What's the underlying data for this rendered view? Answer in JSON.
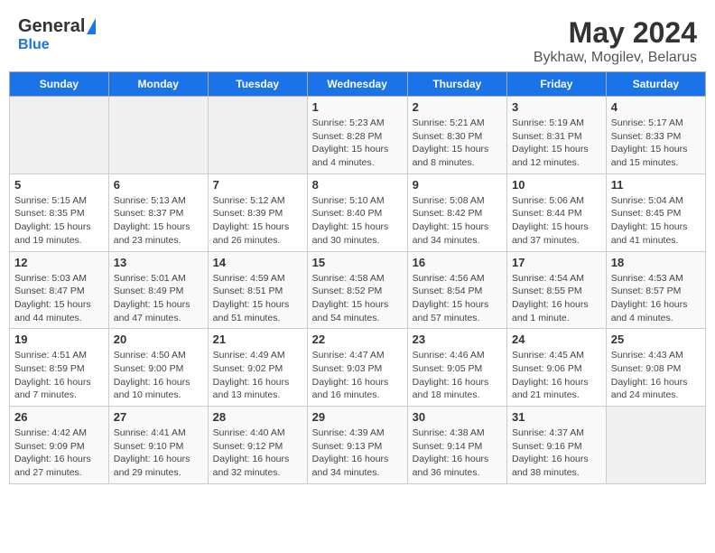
{
  "header": {
    "logo_general": "General",
    "logo_blue": "Blue",
    "title": "May 2024",
    "subtitle": "Bykhaw, Mogilev, Belarus"
  },
  "weekdays": [
    "Sunday",
    "Monday",
    "Tuesday",
    "Wednesday",
    "Thursday",
    "Friday",
    "Saturday"
  ],
  "weeks": [
    [
      {
        "day": "",
        "info": ""
      },
      {
        "day": "",
        "info": ""
      },
      {
        "day": "",
        "info": ""
      },
      {
        "day": "1",
        "info": "Sunrise: 5:23 AM\nSunset: 8:28 PM\nDaylight: 15 hours\nand 4 minutes."
      },
      {
        "day": "2",
        "info": "Sunrise: 5:21 AM\nSunset: 8:30 PM\nDaylight: 15 hours\nand 8 minutes."
      },
      {
        "day": "3",
        "info": "Sunrise: 5:19 AM\nSunset: 8:31 PM\nDaylight: 15 hours\nand 12 minutes."
      },
      {
        "day": "4",
        "info": "Sunrise: 5:17 AM\nSunset: 8:33 PM\nDaylight: 15 hours\nand 15 minutes."
      }
    ],
    [
      {
        "day": "5",
        "info": "Sunrise: 5:15 AM\nSunset: 8:35 PM\nDaylight: 15 hours\nand 19 minutes."
      },
      {
        "day": "6",
        "info": "Sunrise: 5:13 AM\nSunset: 8:37 PM\nDaylight: 15 hours\nand 23 minutes."
      },
      {
        "day": "7",
        "info": "Sunrise: 5:12 AM\nSunset: 8:39 PM\nDaylight: 15 hours\nand 26 minutes."
      },
      {
        "day": "8",
        "info": "Sunrise: 5:10 AM\nSunset: 8:40 PM\nDaylight: 15 hours\nand 30 minutes."
      },
      {
        "day": "9",
        "info": "Sunrise: 5:08 AM\nSunset: 8:42 PM\nDaylight: 15 hours\nand 34 minutes."
      },
      {
        "day": "10",
        "info": "Sunrise: 5:06 AM\nSunset: 8:44 PM\nDaylight: 15 hours\nand 37 minutes."
      },
      {
        "day": "11",
        "info": "Sunrise: 5:04 AM\nSunset: 8:45 PM\nDaylight: 15 hours\nand 41 minutes."
      }
    ],
    [
      {
        "day": "12",
        "info": "Sunrise: 5:03 AM\nSunset: 8:47 PM\nDaylight: 15 hours\nand 44 minutes."
      },
      {
        "day": "13",
        "info": "Sunrise: 5:01 AM\nSunset: 8:49 PM\nDaylight: 15 hours\nand 47 minutes."
      },
      {
        "day": "14",
        "info": "Sunrise: 4:59 AM\nSunset: 8:51 PM\nDaylight: 15 hours\nand 51 minutes."
      },
      {
        "day": "15",
        "info": "Sunrise: 4:58 AM\nSunset: 8:52 PM\nDaylight: 15 hours\nand 54 minutes."
      },
      {
        "day": "16",
        "info": "Sunrise: 4:56 AM\nSunset: 8:54 PM\nDaylight: 15 hours\nand 57 minutes."
      },
      {
        "day": "17",
        "info": "Sunrise: 4:54 AM\nSunset: 8:55 PM\nDaylight: 16 hours\nand 1 minute."
      },
      {
        "day": "18",
        "info": "Sunrise: 4:53 AM\nSunset: 8:57 PM\nDaylight: 16 hours\nand 4 minutes."
      }
    ],
    [
      {
        "day": "19",
        "info": "Sunrise: 4:51 AM\nSunset: 8:59 PM\nDaylight: 16 hours\nand 7 minutes."
      },
      {
        "day": "20",
        "info": "Sunrise: 4:50 AM\nSunset: 9:00 PM\nDaylight: 16 hours\nand 10 minutes."
      },
      {
        "day": "21",
        "info": "Sunrise: 4:49 AM\nSunset: 9:02 PM\nDaylight: 16 hours\nand 13 minutes."
      },
      {
        "day": "22",
        "info": "Sunrise: 4:47 AM\nSunset: 9:03 PM\nDaylight: 16 hours\nand 16 minutes."
      },
      {
        "day": "23",
        "info": "Sunrise: 4:46 AM\nSunset: 9:05 PM\nDaylight: 16 hours\nand 18 minutes."
      },
      {
        "day": "24",
        "info": "Sunrise: 4:45 AM\nSunset: 9:06 PM\nDaylight: 16 hours\nand 21 minutes."
      },
      {
        "day": "25",
        "info": "Sunrise: 4:43 AM\nSunset: 9:08 PM\nDaylight: 16 hours\nand 24 minutes."
      }
    ],
    [
      {
        "day": "26",
        "info": "Sunrise: 4:42 AM\nSunset: 9:09 PM\nDaylight: 16 hours\nand 27 minutes."
      },
      {
        "day": "27",
        "info": "Sunrise: 4:41 AM\nSunset: 9:10 PM\nDaylight: 16 hours\nand 29 minutes."
      },
      {
        "day": "28",
        "info": "Sunrise: 4:40 AM\nSunset: 9:12 PM\nDaylight: 16 hours\nand 32 minutes."
      },
      {
        "day": "29",
        "info": "Sunrise: 4:39 AM\nSunset: 9:13 PM\nDaylight: 16 hours\nand 34 minutes."
      },
      {
        "day": "30",
        "info": "Sunrise: 4:38 AM\nSunset: 9:14 PM\nDaylight: 16 hours\nand 36 minutes."
      },
      {
        "day": "31",
        "info": "Sunrise: 4:37 AM\nSunset: 9:16 PM\nDaylight: 16 hours\nand 38 minutes."
      },
      {
        "day": "",
        "info": ""
      }
    ]
  ]
}
